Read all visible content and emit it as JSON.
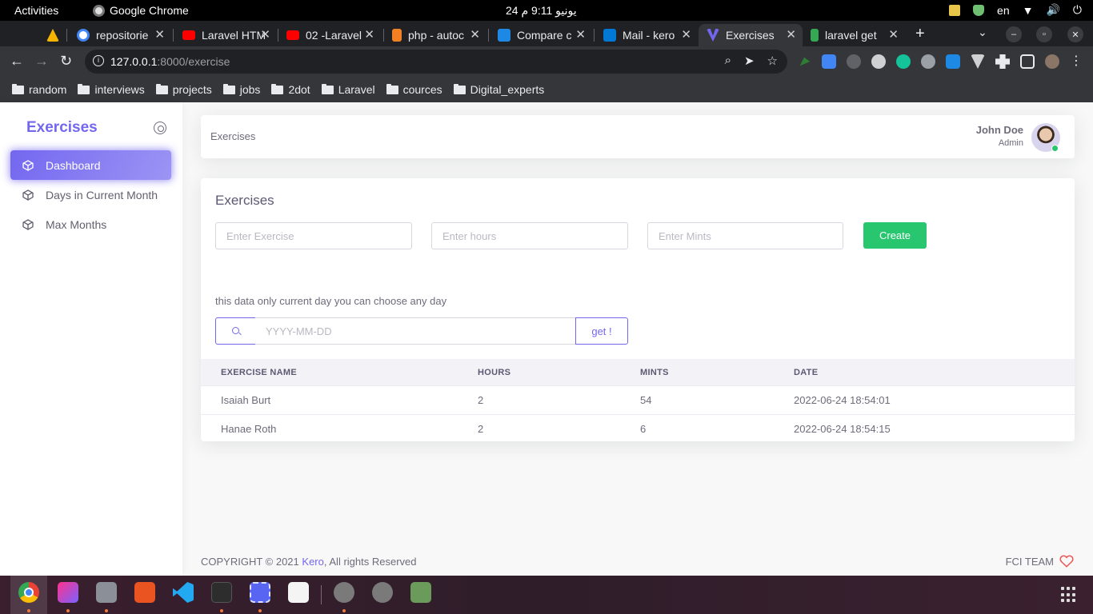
{
  "system": {
    "activities": "Activities",
    "app_name": "Google Chrome",
    "clock": "24 يونيو 9:11 م",
    "lang": "en"
  },
  "tabs": [
    {
      "title": "",
      "icon": "triangle-logo-icon",
      "color": "#f4b400"
    },
    {
      "title": "repositorie",
      "icon": "google-icon",
      "color": "#ffffff"
    },
    {
      "title": "Laravel HTM",
      "icon": "youtube-icon",
      "color": "#ff0000"
    },
    {
      "title": "02 -Laravel",
      "icon": "youtube-icon",
      "color": "#ff0000"
    },
    {
      "title": "php - autoc",
      "icon": "stackoverflow-icon",
      "color": "#f48024"
    },
    {
      "title": "Compare c",
      "icon": "rs-icon",
      "color": "#1e88e5"
    },
    {
      "title": "Mail - kero",
      "icon": "outlook-icon",
      "color": "#0078d4"
    },
    {
      "title": "Exercises",
      "icon": "vuexy-icon",
      "color": "#7367f0"
    },
    {
      "title": "laravel get",
      "icon": "pen-icon",
      "color": "#34a853"
    }
  ],
  "browser": {
    "url_host": "127.0.0.1",
    "url_rest": ":8000/exercise"
  },
  "bookmarks": [
    "random",
    "interviews",
    "projects",
    "jobs",
    "2dot",
    "Laravel",
    "cources",
    "Digital_experts"
  ],
  "sidebar": {
    "brand": "Exercises",
    "items": [
      {
        "label": "Dashboard",
        "active": true
      },
      {
        "label": "Days in Current Month",
        "active": false
      },
      {
        "label": "Max Months",
        "active": false
      }
    ]
  },
  "header": {
    "breadcrumb": "Exercises",
    "user_name": "John Doe",
    "user_role": "Admin"
  },
  "form": {
    "title": "Exercises",
    "exercise_placeholder": "Enter Exercise",
    "hours_placeholder": "Enter hours",
    "mints_placeholder": "Enter Mints",
    "create_label": "Create",
    "note": "this data only current day you can choose any day",
    "date_placeholder": "YYYY-MM-DD",
    "get_label": "get !"
  },
  "table": {
    "headers": [
      "EXERCISE NAME",
      "HOURS",
      "MINTS",
      "DATE"
    ],
    "rows": [
      {
        "name": "Isaiah Burt",
        "hours": "2",
        "mints": "54",
        "date": "2022-06-24 18:54:01"
      },
      {
        "name": "Hanae Roth",
        "hours": "2",
        "mints": "6",
        "date": "2022-06-24 18:54:15"
      }
    ]
  },
  "footer": {
    "copyright": "COPYRIGHT © 2021",
    "brand_link": "Kero",
    "rights": ", All rights Reserved",
    "team": "FCI TEAM"
  },
  "colors": {
    "primary": "#7367f0",
    "success": "#28c76f",
    "text": "#6e6b7b"
  }
}
